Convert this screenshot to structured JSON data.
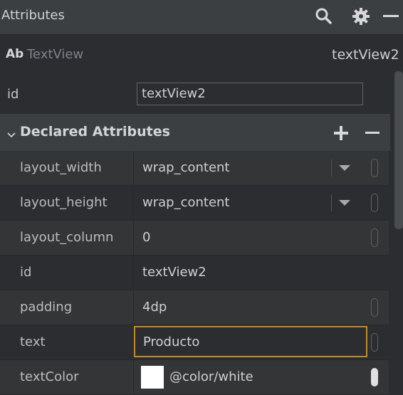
{
  "panel": {
    "title": "Attributes",
    "icons": {
      "search": "search-icon",
      "settings": "gear-icon",
      "minimize": "minimize-icon"
    }
  },
  "component": {
    "badge": "Ab",
    "class_name": "TextView",
    "id": "textView2"
  },
  "id_field": {
    "label": "id",
    "value": "textView2"
  },
  "section": {
    "title": "Declared Attributes",
    "add_label": "+",
    "remove_label": "−"
  },
  "attributes": [
    {
      "name": "layout_width",
      "value": "wrap_content"
    },
    {
      "name": "layout_height",
      "value": "wrap_content"
    },
    {
      "name": "layout_column",
      "value": "0"
    },
    {
      "name": "id",
      "value": "textView2"
    },
    {
      "name": "padding",
      "value": "4dp"
    },
    {
      "name": "text",
      "value": "Producto"
    },
    {
      "name": "textColor",
      "value": "@color/white",
      "swatch_color": "#ffffff"
    }
  ],
  "colors": {
    "focus_border": "#c18b2a",
    "panel_bg": "#2b2d30",
    "header_bg": "#3c3f41"
  }
}
